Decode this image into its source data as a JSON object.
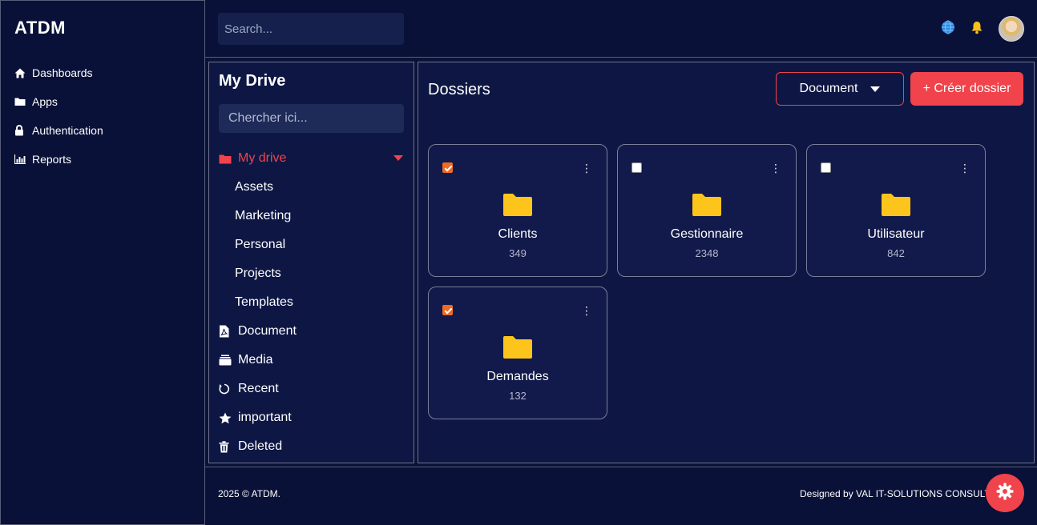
{
  "app": {
    "brand": "ATDM"
  },
  "sidebar": {
    "items": [
      {
        "label": "Dashboards",
        "icon": "home-icon"
      },
      {
        "label": "Apps",
        "icon": "folder-icon"
      },
      {
        "label": "Authentication",
        "icon": "lock-icon"
      },
      {
        "label": "Reports",
        "icon": "bar-chart-icon"
      }
    ]
  },
  "topbar": {
    "search_placeholder": "Search...",
    "icons": [
      "globe-icon",
      "bell-icon",
      "avatar"
    ]
  },
  "drive": {
    "title": "My Drive",
    "search_placeholder": "Chercher ici...",
    "root": {
      "label": "My drive",
      "icon": "folder-icon",
      "expanded": true
    },
    "subfolders": [
      "Assets",
      "Marketing",
      "Personal",
      "Projects",
      "Templates"
    ],
    "sections": [
      {
        "label": "Document",
        "icon": "pdf-file-icon"
      },
      {
        "label": "Media",
        "icon": "media-stack-icon"
      },
      {
        "label": "Recent",
        "icon": "history-icon"
      },
      {
        "label": "important",
        "icon": "star-icon"
      },
      {
        "label": "Deleted",
        "icon": "trash-icon"
      }
    ]
  },
  "main": {
    "title": "Dossiers",
    "filter_label": "Document",
    "create_label": "+ Créer dossier",
    "folders": [
      {
        "name": "Clients",
        "count": "349",
        "checked": true
      },
      {
        "name": "Gestionnaire",
        "count": "2348",
        "checked": false
      },
      {
        "name": "Utilisateur",
        "count": "842",
        "checked": false
      },
      {
        "name": "Demandes",
        "count": "132",
        "checked": true
      }
    ]
  },
  "footer": {
    "copyright": "2025 © ATDM.",
    "credit": "Designed by VAL IT-SOLUTIONS CONSULTING"
  },
  "colors": {
    "background": "#0b1238",
    "panel": "#0e1744",
    "accent": "#f0434b",
    "folder": "#fdc51c",
    "checkbox": "#f06a24"
  }
}
